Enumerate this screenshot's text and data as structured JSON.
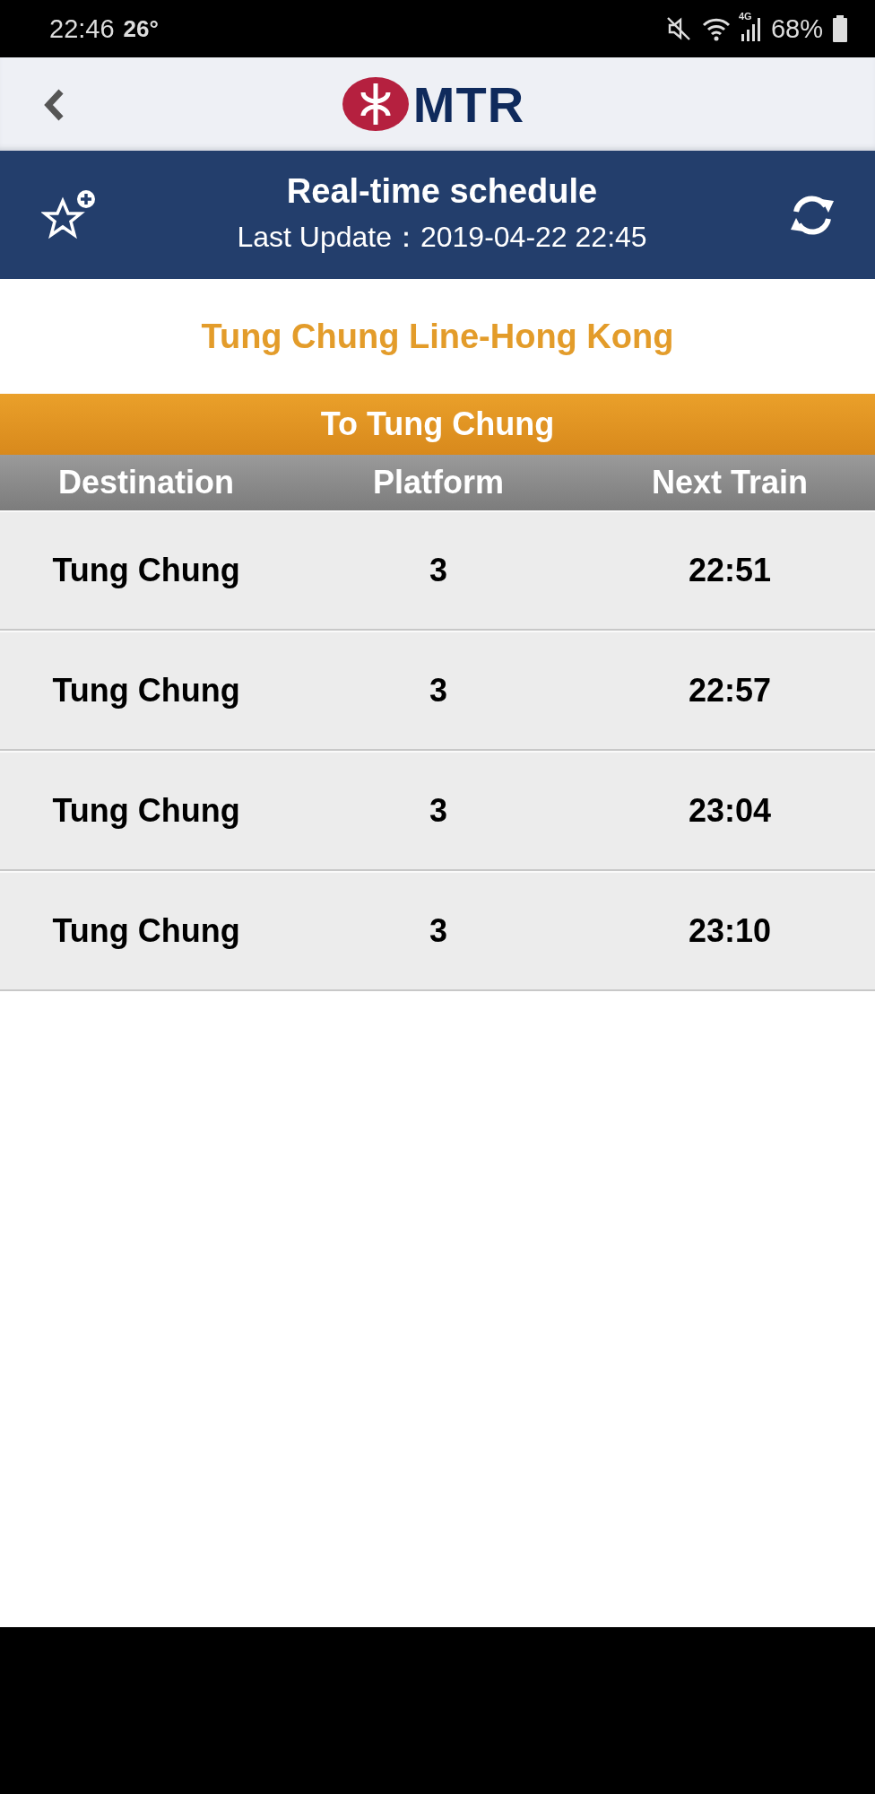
{
  "status_bar": {
    "time": "22:46",
    "temperature": "26°",
    "network": "4G",
    "battery": "68%"
  },
  "header": {
    "logo_text": "MTR"
  },
  "title_bar": {
    "title": "Real-time schedule",
    "last_update": "Last Update：2019-04-22 22:45"
  },
  "route_title": "Tung Chung Line-Hong Kong",
  "direction": "To Tung Chung",
  "table": {
    "columns": [
      "Destination",
      "Platform",
      "Next Train"
    ],
    "rows": [
      {
        "destination": "Tung Chung",
        "platform": "3",
        "next_train": "22:51"
      },
      {
        "destination": "Tung Chung",
        "platform": "3",
        "next_train": "22:57"
      },
      {
        "destination": "Tung Chung",
        "platform": "3",
        "next_train": "23:04"
      },
      {
        "destination": "Tung Chung",
        "platform": "3",
        "next_train": "23:10"
      }
    ]
  }
}
